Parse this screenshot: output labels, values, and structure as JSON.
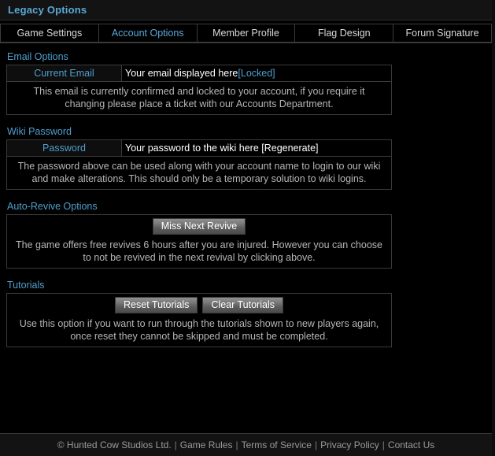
{
  "header": {
    "title": "Legacy Options"
  },
  "tabs": [
    {
      "label": "Game Settings",
      "active": false
    },
    {
      "label": "Account Options",
      "active": true
    },
    {
      "label": "Member Profile",
      "active": false
    },
    {
      "label": "Flag Design",
      "active": false
    },
    {
      "label": "Forum Signature",
      "active": false
    }
  ],
  "sections": {
    "email": {
      "heading": "Email Options",
      "label": "Current Email",
      "value": "Your email displayed here",
      "action": "[Locked]",
      "description": "This email is currently confirmed and locked to your account, if you require it changing please place a ticket with our Accounts Department."
    },
    "wiki": {
      "heading": "Wiki Password",
      "label": "Password",
      "value": "Your password to the wiki here ",
      "action": "[Regenerate]",
      "description": "The password above can be used along with your account name to login to our wiki and make alterations. This should only be a temporary solution to wiki logins."
    },
    "revive": {
      "heading": "Auto-Revive Options",
      "button": "Miss Next Revive",
      "description": "The game offers free revives 6 hours after you are injured. However you can choose to not be revived in the next revival by clicking above."
    },
    "tutorials": {
      "heading": "Tutorials",
      "button_reset": "Reset Tutorials",
      "button_clear": "Clear Tutorials",
      "description": "Use this option if you want to run through the tutorials shown to new players again, once reset they cannot be skipped and must be completed."
    }
  },
  "footer": {
    "copyright": "© Hunted Cow Studios Ltd.",
    "links": [
      "Game Rules",
      "Terms of Service",
      "Privacy Policy",
      "Contact Us"
    ],
    "separator": "|"
  },
  "colors": {
    "accent_blue": "#4f9fcf",
    "page_bg": "#000000",
    "panel_border": "#3a3a3a",
    "value_text": "#ffffff"
  }
}
